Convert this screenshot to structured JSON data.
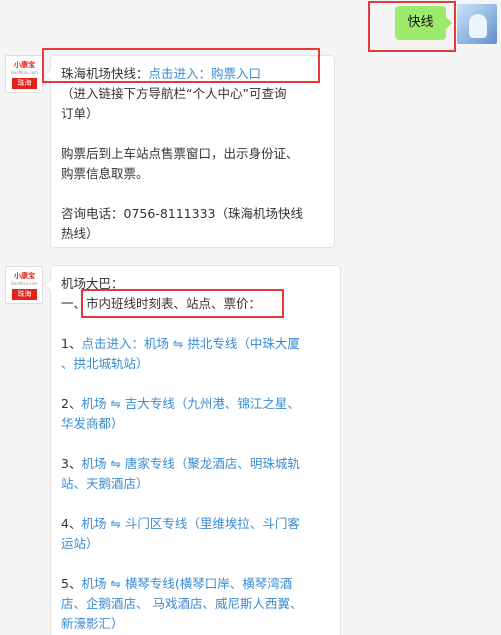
{
  "me": {
    "message": "快线"
  },
  "bot": {
    "logo_text": "小康宝",
    "logo_url": "BaoMiao.com",
    "logo_city": "珠海"
  },
  "msg1": {
    "title_prefix": "珠海机场快线：",
    "title_link": "点击进入：购票入口",
    "note_line1": "（进入链接下方导航栏“个人中心”可查询",
    "note_line2": "订单）",
    "buy_line1": "购票后到上车站点售票窗口，出示身份证、",
    "buy_line2": "购票信息取票。",
    "phone_line1": "咨询电话：0756-8111333（珠海机场快线",
    "phone_line2": "热线）"
  },
  "msg2": {
    "heading": "机场大巴：",
    "section_prefix": "一、",
    "section_title": "市内班线时刻表、站点、票价：",
    "routes": [
      {
        "num": "1、",
        "line1": "点击进入：机场 ⇋ 拱北专线（中珠大厦",
        "line2": "、拱北城轨站）"
      },
      {
        "num": "2、",
        "line1": "机场 ⇋ 吉大专线（九州港、锦江之星、",
        "line2": "华发商都）"
      },
      {
        "num": "3、",
        "line1": "机场 ⇋ 唐家专线（聚龙酒店、明珠城轨",
        "line2": "站、天鹅酒店）"
      },
      {
        "num": "4、",
        "line1": "机场 ⇋ 斗门区专线（里维埃拉、斗门客",
        "line2": "运站）"
      },
      {
        "num": "5、",
        "line1": "机场 ⇋ 横琴专线(横琴口岸、横琴湾酒",
        "line2": "店、企鹅酒店、 马戏酒店、威尼斯人西翼、",
        "line3": "新濠影汇）"
      }
    ]
  }
}
